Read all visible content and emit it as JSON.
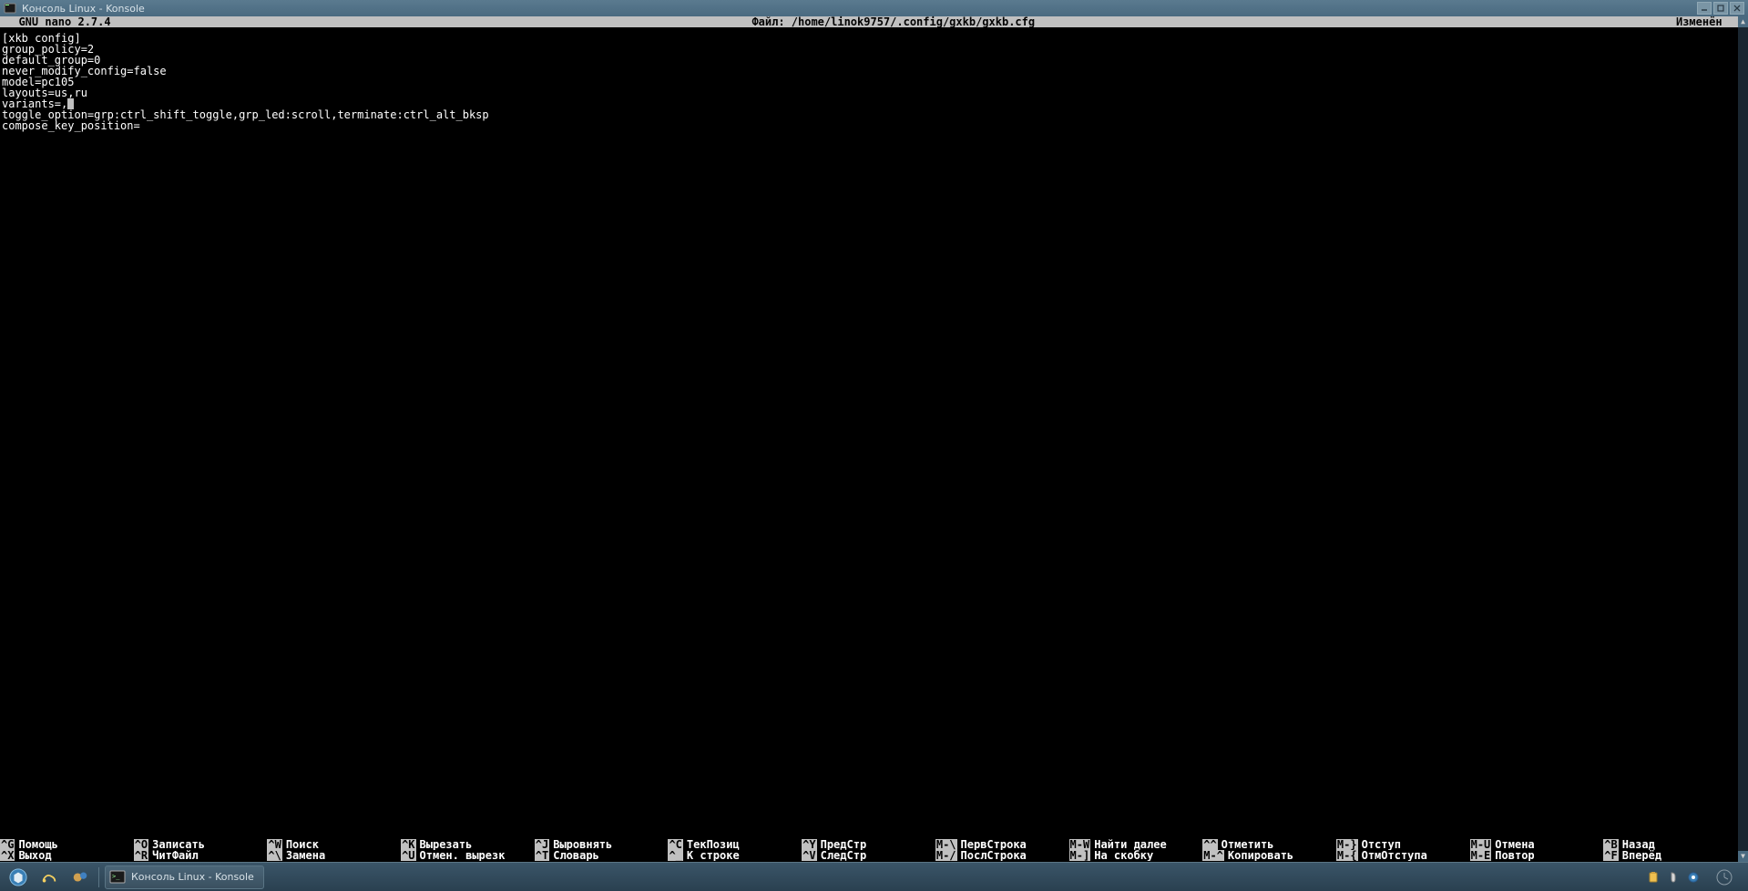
{
  "window": {
    "title": "Консоль Linux - Konsole"
  },
  "nano": {
    "app": "  GNU nano 2.7.4",
    "file_label": "Файл: /home/linok9757/.config/gxkb/gxkb.cfg",
    "status": "Изменён  ",
    "content": [
      "[xkb config]",
      "group_policy=2",
      "default_group=0",
      "never_modify_config=false",
      "model=pc105",
      "layouts=us,ru",
      "variants=,",
      "toggle_option=grp:ctrl_shift_toggle,grp_led:scroll,terminate:ctrl_alt_bksp",
      "compose_key_position="
    ],
    "cursor_line": 6,
    "shortcuts_row1": [
      {
        "key": "^G",
        "label": "Помощь"
      },
      {
        "key": "^O",
        "label": "Записать"
      },
      {
        "key": "^W",
        "label": "Поиск"
      },
      {
        "key": "^K",
        "label": "Вырезать"
      },
      {
        "key": "^J",
        "label": "Выровнять"
      },
      {
        "key": "^C",
        "label": "ТекПозиц"
      },
      {
        "key": "^Y",
        "label": "ПредСтр"
      },
      {
        "key": "M-\\",
        "label": "ПервСтрока"
      },
      {
        "key": "M-W",
        "label": "Найти далее"
      },
      {
        "key": "^^",
        "label": "Отметить"
      },
      {
        "key": "M-}",
        "label": "Отступ"
      },
      {
        "key": "M-U",
        "label": "Отмена"
      }
    ],
    "shortcuts_row2": [
      {
        "key": "^X",
        "label": "Выход"
      },
      {
        "key": "^R",
        "label": "ЧитФайл"
      },
      {
        "key": "^\\",
        "label": "Замена"
      },
      {
        "key": "^U",
        "label": "Отмен. вырезк"
      },
      {
        "key": "^T",
        "label": "Словарь"
      },
      {
        "key": "^_",
        "label": "К строке"
      },
      {
        "key": "^V",
        "label": "СледСтр"
      },
      {
        "key": "M-/",
        "label": "ПослСтрока"
      },
      {
        "key": "M-]",
        "label": "На скобку"
      },
      {
        "key": "M-^",
        "label": "Копировать"
      },
      {
        "key": "M-{",
        "label": "ОтмОтступа"
      },
      {
        "key": "M-E",
        "label": "Повтор"
      }
    ],
    "shortcuts_extra_row1": {
      "key": "^B",
      "label": "Назад"
    },
    "shortcuts_extra_row2": {
      "key": "^F",
      "label": "Вперёд"
    }
  },
  "taskbar": {
    "task_label": "Консоль Linux - Konsole"
  }
}
